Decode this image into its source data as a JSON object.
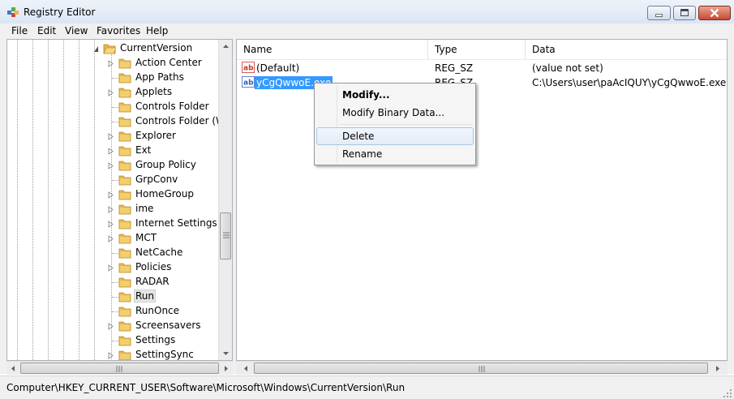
{
  "window": {
    "title": "Registry Editor"
  },
  "menu": [
    "File",
    "Edit",
    "View",
    "Favorites",
    "Help"
  ],
  "tree": {
    "parent": "CurrentVersion",
    "items": [
      {
        "label": "Action Center",
        "expandable": true
      },
      {
        "label": "App Paths",
        "expandable": false
      },
      {
        "label": "Applets",
        "expandable": true
      },
      {
        "label": "Controls Folder",
        "expandable": false
      },
      {
        "label": "Controls Folder (Wo",
        "expandable": false
      },
      {
        "label": "Explorer",
        "expandable": true
      },
      {
        "label": "Ext",
        "expandable": true
      },
      {
        "label": "Group Policy",
        "expandable": true
      },
      {
        "label": "GrpConv",
        "expandable": false
      },
      {
        "label": "HomeGroup",
        "expandable": true
      },
      {
        "label": "ime",
        "expandable": true
      },
      {
        "label": "Internet Settings",
        "expandable": true
      },
      {
        "label": "MCT",
        "expandable": true
      },
      {
        "label": "NetCache",
        "expandable": false
      },
      {
        "label": "Policies",
        "expandable": true
      },
      {
        "label": "RADAR",
        "expandable": false
      },
      {
        "label": "Run",
        "expandable": false,
        "selected": true
      },
      {
        "label": "RunOnce",
        "expandable": false
      },
      {
        "label": "Screensavers",
        "expandable": true
      },
      {
        "label": "Settings",
        "expandable": false
      },
      {
        "label": "SettingSync",
        "expandable": true
      }
    ]
  },
  "list": {
    "columns": [
      "Name",
      "Type",
      "Data"
    ],
    "rows": [
      {
        "name": "(Default)",
        "type": "REG_SZ",
        "data": "(value not set)"
      },
      {
        "name": "yCgQwwoE.exe",
        "type": "REG_SZ",
        "data": "C:\\Users\\user\\paAcIQUY\\yCgQwwoE.exe",
        "selected": true
      }
    ]
  },
  "context_menu": {
    "items": [
      {
        "label": "Modify...",
        "bold": true
      },
      {
        "label": "Modify Binary Data..."
      },
      {
        "label": "Delete",
        "hover": true
      },
      {
        "label": "Rename"
      }
    ]
  },
  "status": {
    "path": "Computer\\HKEY_CURRENT_USER\\Software\\Microsoft\\Windows\\CurrentVersion\\Run"
  },
  "colors": {
    "selection": "#3399ff",
    "folder": "#e8b84a",
    "titlebar": "#dbe6f4"
  }
}
